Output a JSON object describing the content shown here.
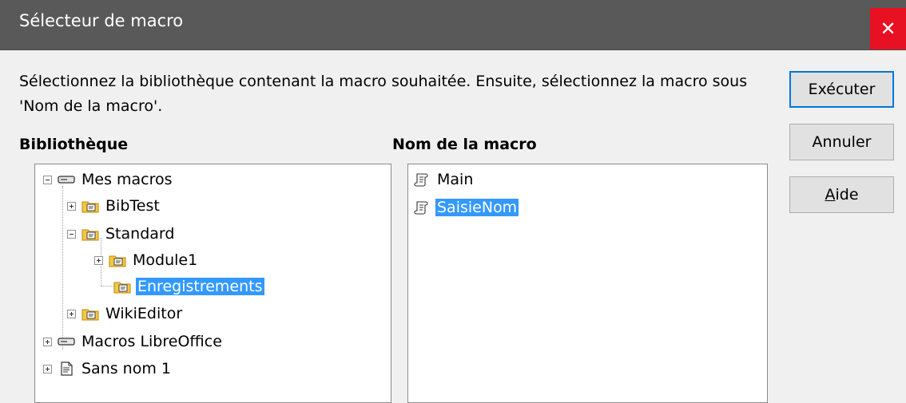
{
  "window": {
    "title": "Sélecteur de macro",
    "close_symbol": "✕"
  },
  "description": "Sélectionnez la bibliothèque contenant la macro souhaitée. Ensuite, sélectionnez la macro sous 'Nom de la macro'.",
  "library": {
    "heading": "Bibliothèque",
    "items": [
      {
        "label": "Mes macros",
        "icon": "drive-icon",
        "expander": "minus",
        "selected": false
      },
      {
        "label": "BibTest",
        "icon": "library-folder-icon",
        "expander": "plus",
        "selected": false
      },
      {
        "label": "Standard",
        "icon": "library-folder-icon",
        "expander": "minus",
        "selected": false
      },
      {
        "label": "Module1",
        "icon": "library-folder-icon",
        "expander": "plus",
        "selected": false
      },
      {
        "label": "Enregistrements",
        "icon": "library-folder-icon",
        "expander": "none",
        "selected": true
      },
      {
        "label": "WikiEditor",
        "icon": "library-folder-icon",
        "expander": "plus",
        "selected": false
      },
      {
        "label": "Macros LibreOffice",
        "icon": "drive-icon",
        "expander": "plus",
        "selected": false
      },
      {
        "label": "Sans nom 1",
        "icon": "document-icon",
        "expander": "plus",
        "selected": false
      }
    ]
  },
  "macros": {
    "heading": "Nom de la macro",
    "items": [
      {
        "label": "Main",
        "icon": "macro-scroll-icon",
        "selected": false
      },
      {
        "label": "SaisieNom",
        "icon": "macro-scroll-icon",
        "selected": true
      }
    ]
  },
  "buttons": {
    "run": "Exécuter",
    "cancel": "Annuler",
    "help_mnemonic": "A",
    "help_rest": "ide"
  },
  "colors": {
    "selection": "#3399ff",
    "close": "#e81123",
    "titlebar": "#595959",
    "default_border": "#0078d7"
  }
}
